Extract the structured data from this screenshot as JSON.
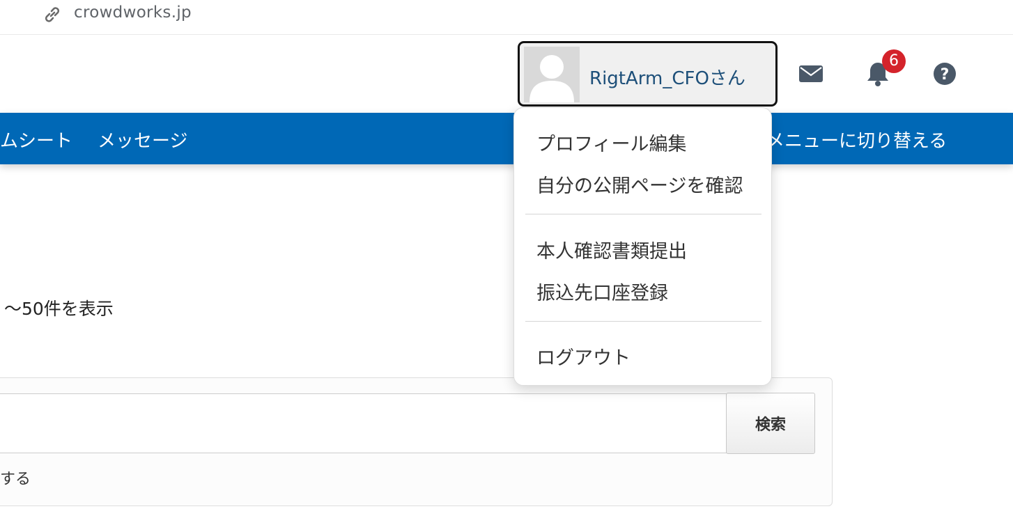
{
  "browser": {
    "url": "crowdworks.jp",
    "url_icon": "link-icon"
  },
  "header": {
    "user_name": "RigtArm_CFOさん",
    "avatar_icon": "default-avatar-icon",
    "notification_count": "6",
    "icons": [
      "mail-icon",
      "bell-icon",
      "help-icon"
    ]
  },
  "nav": {
    "items": [
      "ムシート",
      "メッセージ",
      "メニューに切り替える"
    ],
    "background": "#0068b6"
  },
  "main": {
    "result_count_text": "〜50件を表示",
    "search_button": "検索",
    "search_option_text": "する"
  },
  "dropdown": {
    "items": [
      "プロフィール編集",
      "自分の公開ページを確認",
      "本人確認書類提出",
      "振込先口座登録",
      "ログアウト"
    ]
  },
  "colors": {
    "accent": "#0068b6",
    "user_name": "#1d4f79",
    "badge": "#d4232b",
    "icon": "#4a5868"
  }
}
